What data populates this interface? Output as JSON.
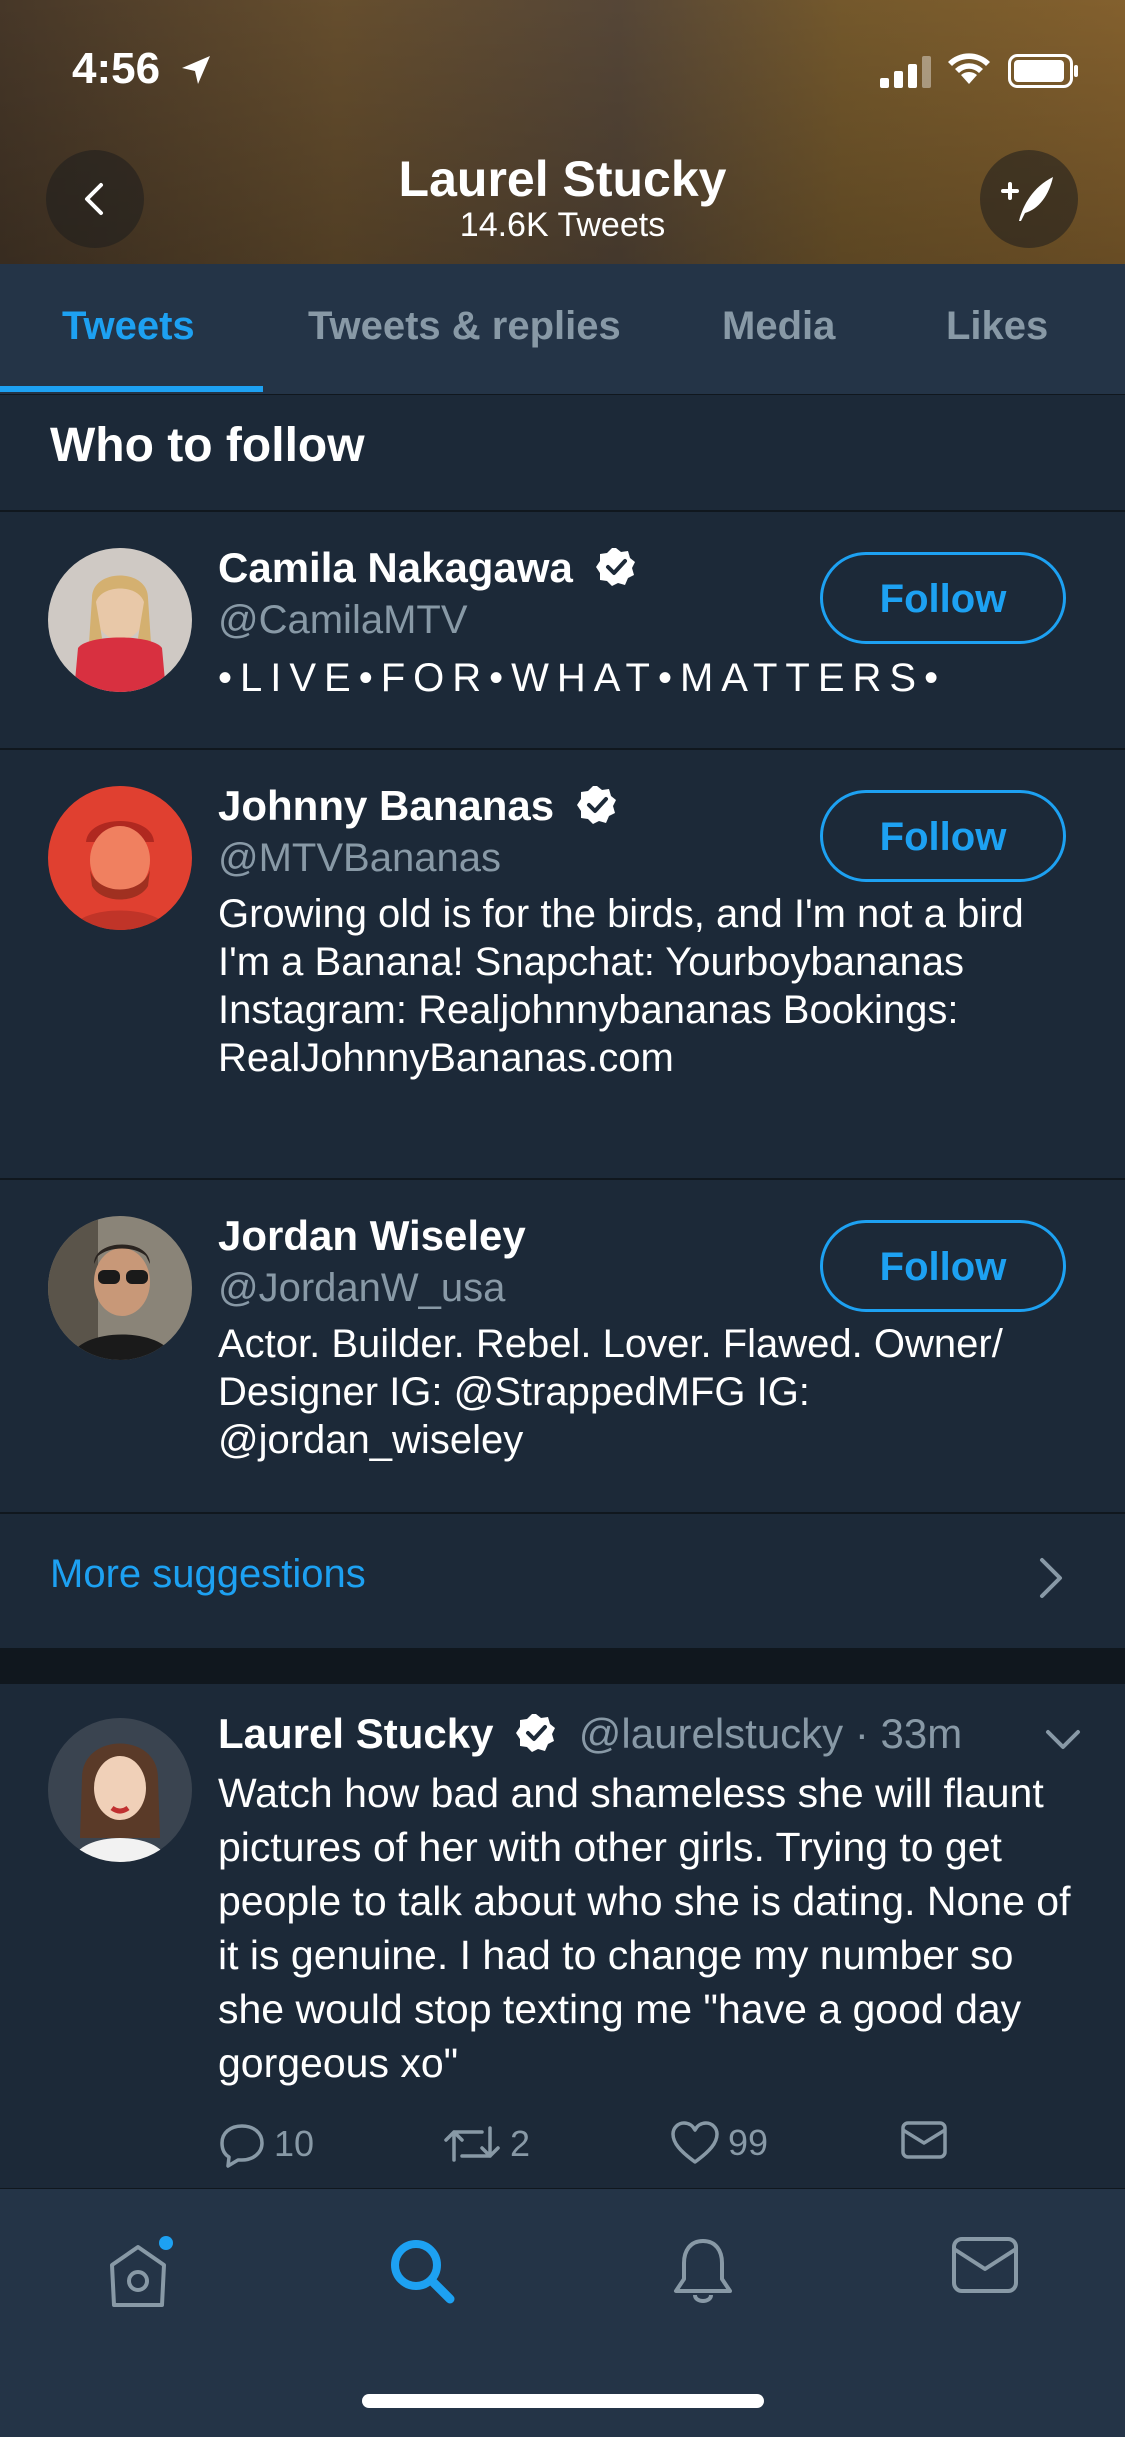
{
  "status_bar": {
    "time": "4:56"
  },
  "header": {
    "name": "Laurel Stucky",
    "tweet_count": "14.6K Tweets"
  },
  "tabs": [
    {
      "label": "Tweets",
      "active": true
    },
    {
      "label": "Tweets & replies",
      "active": false
    },
    {
      "label": "Media",
      "active": false
    },
    {
      "label": "Likes",
      "active": false
    }
  ],
  "who_to_follow": {
    "title": "Who to follow",
    "follow_label": "Follow",
    "users": [
      {
        "name": "Camila Nakagawa",
        "verified": true,
        "handle": "@CamilaMTV",
        "bio": "•LIVE•FOR•WHAT•MATTERS•"
      },
      {
        "name": "Johnny Bananas",
        "verified": true,
        "handle": "@MTVBananas",
        "bio": "Growing old is for the birds, and I'm not a bird I'm a Banana! Snapchat: Yourboybananas Instagram: Realjohnnybananas Bookings: RealJohnnyBananas.com"
      },
      {
        "name": "Jordan Wiseley",
        "verified": false,
        "handle": "@JordanW_usa",
        "bio": "Actor. Builder. Rebel. Lover. Flawed. Owner/ Designer IG: @StrappedMFG IG: @jordan_wiseley"
      }
    ],
    "more_label": "More suggestions"
  },
  "tweet": {
    "name": "Laurel Stucky",
    "verified": true,
    "handle": "@laurelstucky",
    "time": "· 33m",
    "text": "Watch how bad and shameless she will flaunt pictures of her with other girls. Trying to get people to talk about who she is dating. None of it is genuine. I had to change my number so she would stop texting me \"have a good day gorgeous xo\"",
    "replies": "10",
    "retweets": "2",
    "likes": "99"
  },
  "colors": {
    "accent": "#1da1f2",
    "background": "#1c2938",
    "secondary_text": "#8899a6"
  },
  "icons": [
    "back-icon",
    "compose-tweet-icon",
    "verified-icon",
    "chevron-right-icon",
    "chevron-down-icon",
    "reply-icon",
    "retweet-icon",
    "like-icon",
    "dm-icon",
    "home-icon",
    "search-icon",
    "notifications-icon",
    "messages-icon"
  ]
}
